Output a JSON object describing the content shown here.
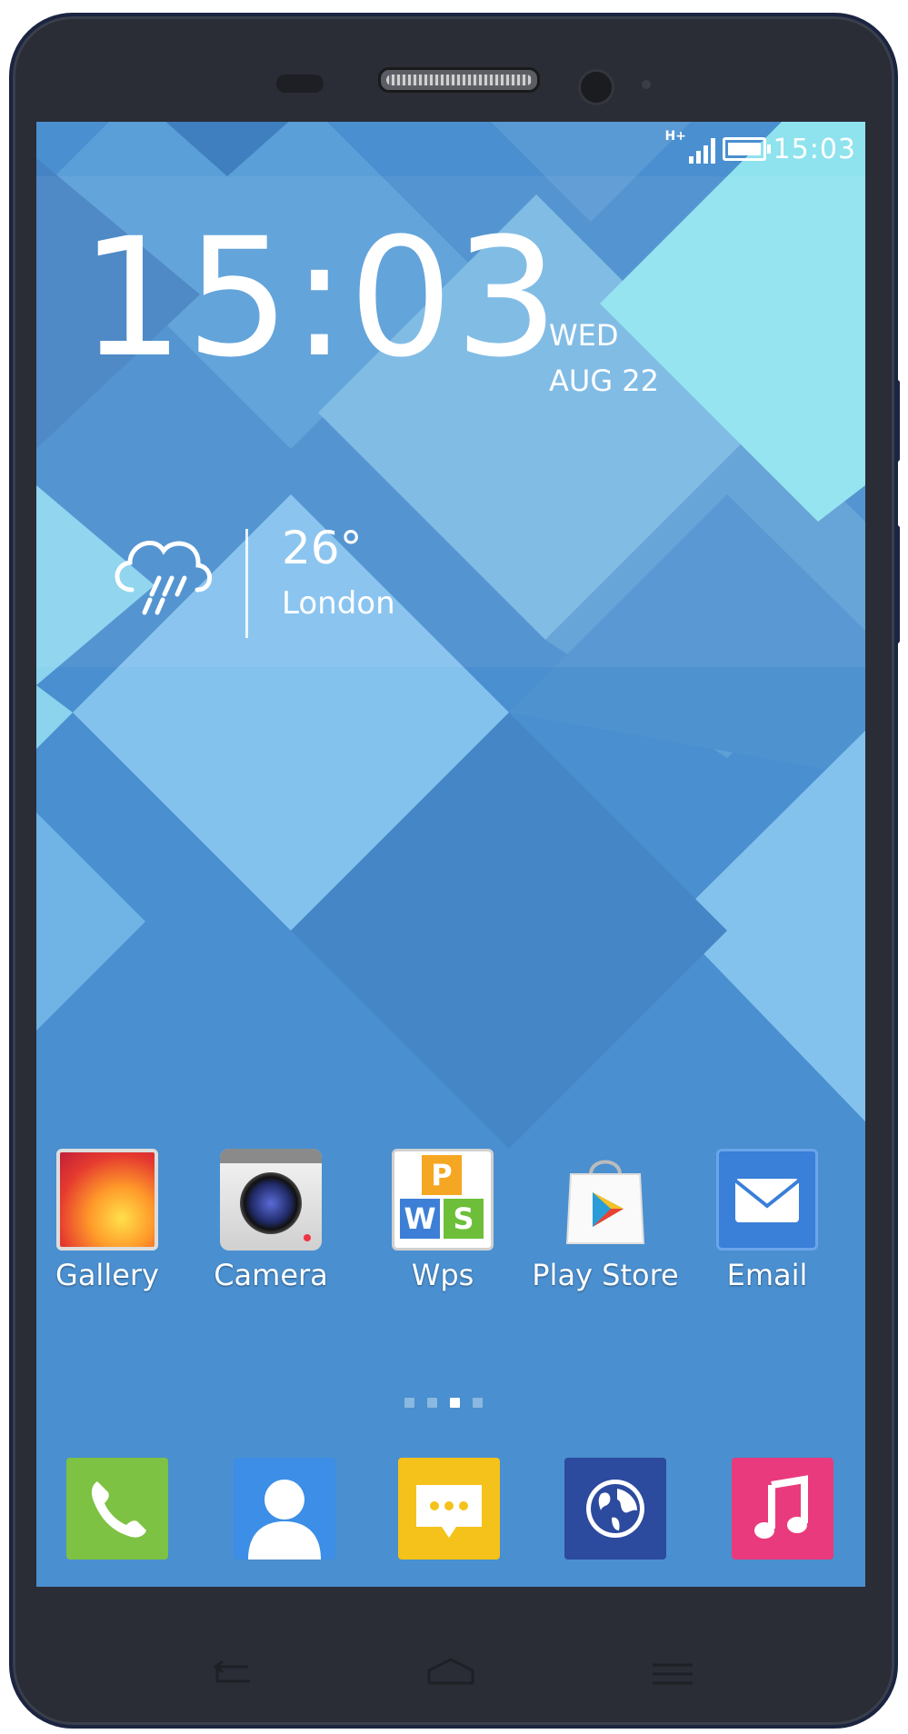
{
  "status_bar": {
    "network": "H+",
    "time": "15:03"
  },
  "clock_widget": {
    "time": "15:03",
    "day": "WED",
    "date": "AUG 22"
  },
  "weather_widget": {
    "temperature": "26°",
    "city": "London",
    "condition_icon": "rain-cloud-icon"
  },
  "apps": [
    {
      "label": "Gallery",
      "icon": "gallery-icon"
    },
    {
      "label": "Camera",
      "icon": "camera-icon"
    },
    {
      "label": "Wps",
      "icon": "wps-icon"
    },
    {
      "label": "Play Store",
      "icon": "play-store-icon"
    },
    {
      "label": "Email",
      "icon": "email-icon"
    }
  ],
  "page_indicator": {
    "pages": 4,
    "active": 3
  },
  "dock": [
    {
      "icon": "phone-icon",
      "color": "#7dc242"
    },
    {
      "icon": "contacts-icon",
      "color": "#3c8ee6"
    },
    {
      "icon": "messaging-icon",
      "color": "#f4c21a"
    },
    {
      "icon": "browser-icon",
      "color": "#2c4a9e"
    },
    {
      "icon": "music-icon",
      "color": "#e93a7d"
    }
  ],
  "colors": {
    "wallpaper_base": "#4a8fcf",
    "wallpaper_light": "#8cc8f0",
    "wallpaper_cyan": "#8fe3ee",
    "phone_body": "#2a2d36"
  }
}
